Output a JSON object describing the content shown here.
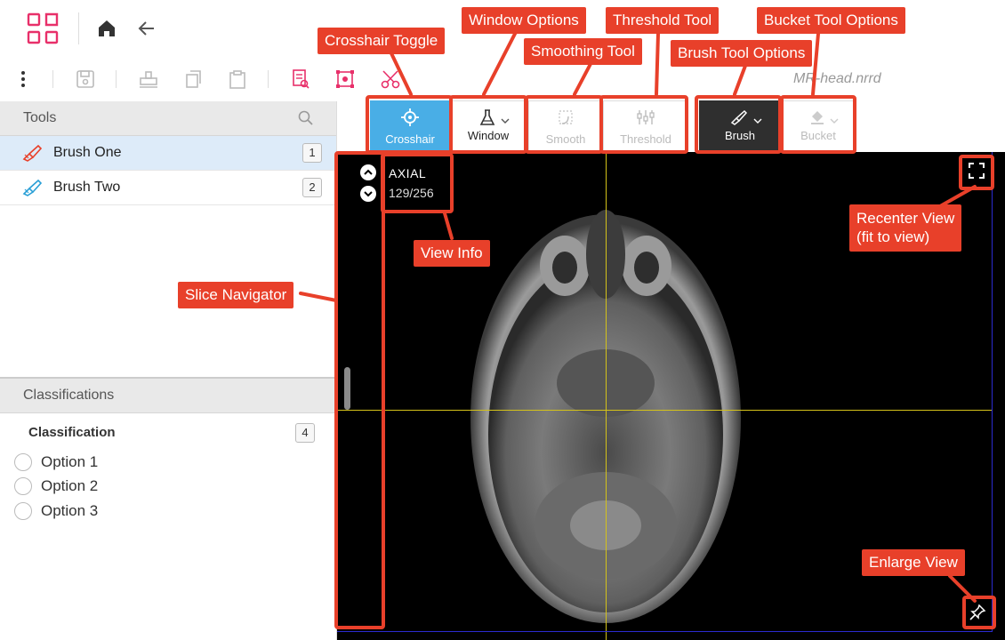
{
  "header": {
    "logo_icon": "grid-logo-icon",
    "home_icon": "home-icon",
    "back_icon": "back-arrow-icon"
  },
  "toolbar": {
    "icons": [
      "more-vertical-icon",
      "save-icon",
      "stamp-icon",
      "copy-icon",
      "paste-icon",
      "annotate-list-icon",
      "bounding-box-icon",
      "scissors-icon"
    ],
    "filename": "MR-head.nrrd"
  },
  "view_tools": [
    {
      "label": "Crosshair",
      "icon": "crosshair-icon",
      "state": "active"
    },
    {
      "label": "Window",
      "icon": "flask-icon",
      "dropdown": true,
      "state": "normal"
    },
    {
      "label": "Smooth",
      "icon": "smooth-icon",
      "state": "disabled"
    },
    {
      "label": "Threshold",
      "icon": "threshold-icon",
      "state": "disabled"
    },
    {
      "label": "Brush",
      "icon": "brush-icon",
      "dropdown": true,
      "state": "selected-dark"
    },
    {
      "label": "Bucket",
      "icon": "bucket-icon",
      "dropdown": true,
      "state": "disabled"
    }
  ],
  "tools_panel": {
    "title": "Tools",
    "search_icon": "search-icon",
    "items": [
      {
        "name": "Brush One",
        "count": "1",
        "color": "#e8402a",
        "selected": true
      },
      {
        "name": "Brush Two",
        "count": "2",
        "color": "#2a9fd6",
        "selected": false
      }
    ]
  },
  "classifications_panel": {
    "title": "Classifications",
    "group_label": "Classification",
    "count": "4",
    "options": [
      "Option 1",
      "Option 2",
      "Option 3"
    ]
  },
  "viewer": {
    "orientation": "AXIAL",
    "slice": "129/256",
    "crosshair_color": "#d4c21a"
  },
  "annotations": {
    "crosshair_toggle": "Crosshair Toggle",
    "window_options": "Window Options",
    "smoothing_tool": "Smoothing Tool",
    "threshold_tool": "Threshold Tool",
    "brush_tool_options": "Brush Tool Options",
    "bucket_tool_options": "Bucket Tool Options",
    "view_info": "View Info",
    "slice_navigator": "Slice Navigator",
    "recenter_line1": "Recenter View",
    "recenter_line2": "(fit to view)",
    "enlarge_view": "Enlarge View",
    "callout_color": "#e8402a"
  }
}
